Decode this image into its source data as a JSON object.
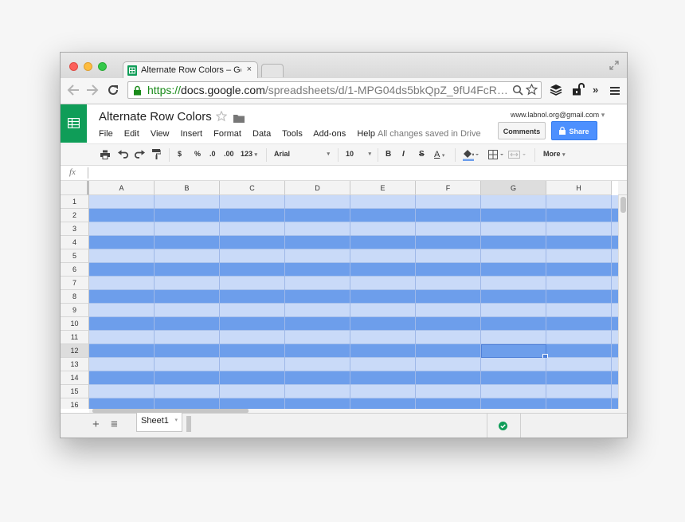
{
  "browser": {
    "tab_title": "Alternate Row Colors – Goo",
    "tab_close": "×",
    "url_scheme": "https://",
    "url_domain": "docs.google.com",
    "url_path": "/spreadsheets/d/1-MPG04ds5bkQpZ_9fU4FcR…",
    "overflow_label": "»"
  },
  "app": {
    "doc_title": "Alternate Row Colors",
    "menu": [
      "File",
      "Edit",
      "View",
      "Insert",
      "Format",
      "Data",
      "Tools",
      "Add-ons",
      "Help"
    ],
    "save_status": "All changes saved in Drive",
    "account": "www.labnol.org@gmail.com",
    "account_caret": "▾",
    "comments_label": "Comments",
    "share_label": "Share"
  },
  "toolbar": {
    "currency": "$",
    "percent": "%",
    "decrease_decimal": ".0",
    "increase_decimal": ".00",
    "more_formats": "123",
    "font": "Arial",
    "font_size": "10",
    "bold": "B",
    "italic": "I",
    "strike": "S",
    "text_color": "A",
    "more": "More"
  },
  "formula_bar": {
    "fx_label": "fx",
    "value": ""
  },
  "grid": {
    "columns": [
      "A",
      "B",
      "C",
      "D",
      "E",
      "F",
      "G",
      "H"
    ],
    "rows": [
      "1",
      "2",
      "3",
      "4",
      "5",
      "6",
      "7",
      "8",
      "9",
      "10",
      "11",
      "12",
      "13",
      "14",
      "15",
      "16"
    ],
    "selected_cell": "G12",
    "even_row_color": "#6d9eeb",
    "odd_row_color": "#c9daf8"
  },
  "sheets": {
    "add_label": "+",
    "list_label": "≡",
    "active_sheet": "Sheet1",
    "sheet_caret": "▾"
  },
  "colors": {
    "sheets_green": "#0f9d58",
    "share_blue": "#4d90fe",
    "ok_green": "#0f9d58"
  }
}
